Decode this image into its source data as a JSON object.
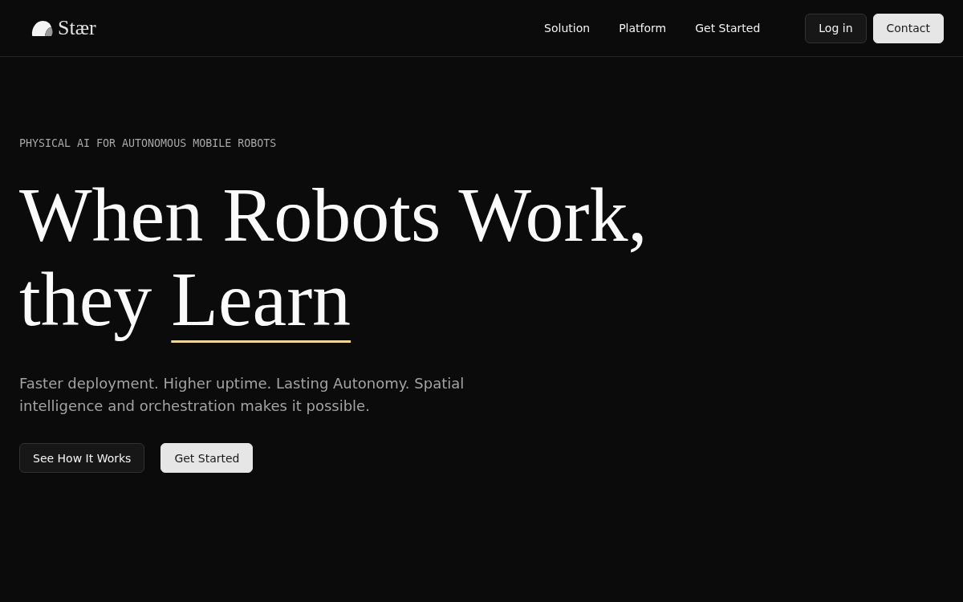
{
  "header": {
    "logo": "Stær",
    "nav": [
      "Solution",
      "Platform",
      "Get Started"
    ],
    "actions": [
      {
        "label": "Log in",
        "kind": "secondary"
      },
      {
        "label": "Contact",
        "kind": "primary"
      }
    ]
  },
  "hero": {
    "eyebrow": "PHYSICAL AI FOR AUTONOMOUS MOBILE ROBOTS",
    "headline": "When Robots Work, they",
    "headline_accent": "Learn",
    "subtitle": "Faster deployment. Higher uptime. Lasting Autonomy. Spatial intelligence and orchestration makes it possible.",
    "buttons": [
      {
        "label": "See How It Works",
        "kind": "secondary"
      },
      {
        "label": "Get Started",
        "kind": "primary"
      }
    ]
  }
}
